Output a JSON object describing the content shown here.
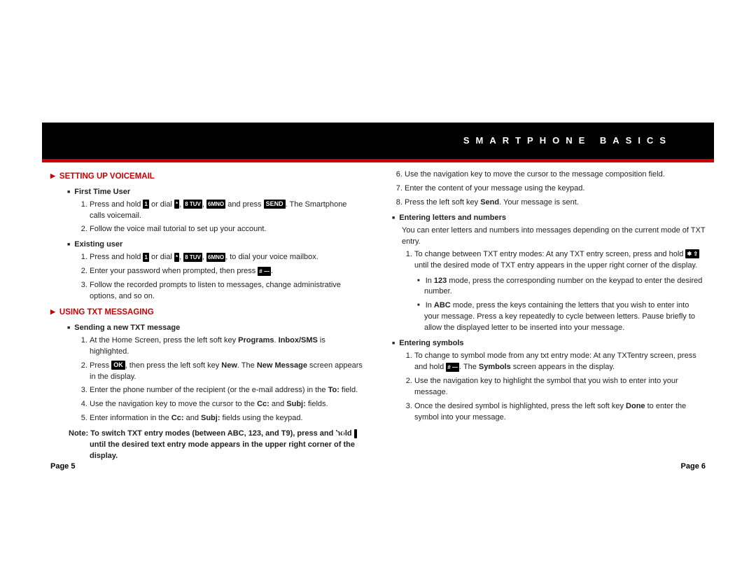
{
  "header": {
    "title": "SMARTPHONE BASICS"
  },
  "left": {
    "s1": {
      "title": "SETTING UP VOICEMAIL",
      "sub1": "First Time User",
      "s1a_pre": "Press and hold ",
      "s1a_mid": " or dial ",
      "s1a_mid2": ", ",
      "s1a_mid3": ", ",
      "s1a_mid4": " and press ",
      "s1a_post": ". The Smartphone calls voicemail.",
      "s1b": "Follow the voice mail tutorial to set up your account.",
      "sub2": "Existing user",
      "s2a_pre": "Press and hold ",
      "s2a_mid": " or dial ",
      "s2a_post": ", to dial your voice mailbox.",
      "s2b_pre": "Enter your password when prompted, then press ",
      "s2b_post": ".",
      "s2c": "Follow the recorded prompts to listen to messages, change administrative options, and so on."
    },
    "s2": {
      "title": "USING TXT MESSAGING",
      "sub1": "Sending a new TXT message",
      "a_pre": "At the Home Screen, press the left soft key ",
      "a_mid": ". ",
      "a_post": " is highlighted.",
      "b_pre": "Press ",
      "b_mid": ", then press the left soft key ",
      "b_mid2": ". The ",
      "b_post": " screen appears in the display.",
      "c_pre": "Enter the phone number of the recipient (or the e-mail address) in the ",
      "c_post": " field.",
      "d_pre": "Use the navigation key to move the cursor to the ",
      "d_mid": " and ",
      "d_post": " fields.",
      "e_pre": "Enter information in the ",
      "e_mid": " and ",
      "e_post": " fields using the keypad.",
      "note_pre": "Note: To switch TXT entry modes (between ABC, 123, and T9), press and hold ",
      "note_post": " until the desired text entry mode appears in the upper right corner of the display."
    }
  },
  "right": {
    "cont6": "Use the navigation key to move the cursor to the message composition field.",
    "cont7": "Enter the content of your message using the keypad.",
    "cont8_pre": "Press the left soft key ",
    "cont8_post": ". Your message is sent.",
    "sub1": "Entering letters and numbers",
    "intro": "You can enter letters and numbers into messages depending on the current mode of TXT entry.",
    "a_pre": "To change between TXT entry modes: At any TXT entry screen, press and hold ",
    "a_post": " until the desired mode of TXT entry appears in the upper right corner of the display.",
    "b1_pre": "In ",
    "b1_post": " mode, press the corresponding number on the keypad to enter the desired number.",
    "b2_pre": "In ",
    "b2_post": " mode, press the keys containing the letters that you wish to enter into your message. Press a key repeatedly to cycle between letters. Pause briefly to allow the displayed letter to be inserted into your message.",
    "sub2": "Entering symbols",
    "c1_pre": "To change to symbol mode from any txt entry mode: At any TXTentry screen, press and hold ",
    "c1_mid": ". The ",
    "c1_post": " screen appears in the display.",
    "c2": "Use the navigation key to highlight the symbol that you wish to enter into your message.",
    "c3_pre": "Once the desired symbol is highlighted, press the left soft key ",
    "c3_post": " to enter the symbol into your message."
  },
  "keys": {
    "one": "1",
    "star": "*",
    "eight": "8 TUV",
    "six": "6MNO",
    "send": "SEND",
    "hash": "# —",
    "ok": "OK",
    "starshift": "✱ ⇧"
  },
  "bold": {
    "programs": "Programs",
    "inboxsms": "Inbox/SMS",
    "new": "New",
    "newmsg": "New Message",
    "to": "To:",
    "cc": "Cc:",
    "subj": "Subj:",
    "send": "Send",
    "m123": "123",
    "abc": "ABC",
    "symbols": "Symbols",
    "done": "Done"
  },
  "pages": {
    "left": "Page 5",
    "right": "Page 6"
  }
}
